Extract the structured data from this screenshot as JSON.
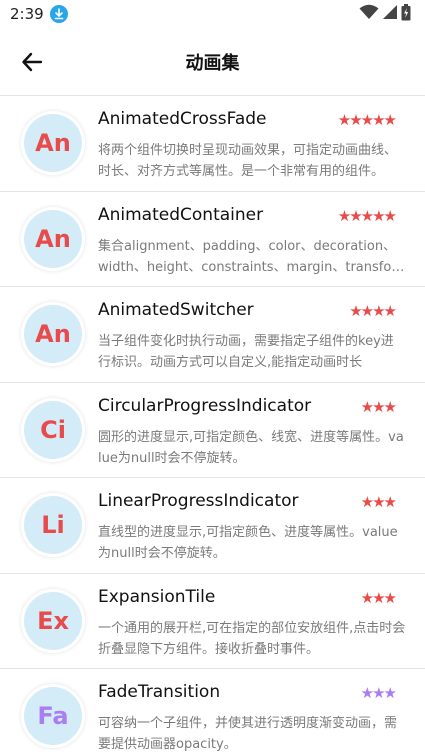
{
  "status": {
    "time": "2:39",
    "download_icon": "download-icon",
    "wifi_icon": "wifi-icon",
    "signal_icon": "signal-icon",
    "battery_icon": "battery-icon"
  },
  "app_bar": {
    "title": "动画集",
    "back_icon": "arrow-back-icon"
  },
  "colors": {
    "avatar_bg": "#d4ecf8",
    "red": "#e84b4b",
    "purple": "#a97ef0"
  },
  "items": [
    {
      "abbr": "An",
      "title": "AnimatedCrossFade",
      "stars": "★★★★★",
      "color": "#e84b4b",
      "desc": "将两个组件切换时呈现动画效果，可指定动画曲线、时长、对齐方式等属性。是一个非常有用的组件。"
    },
    {
      "abbr": "An",
      "title": "AnimatedContainer",
      "stars": "★★★★★",
      "color": "#e84b4b",
      "desc": "集合alignment、padding、color、decoration、width、height、constraints、margin、transform等属性"
    },
    {
      "abbr": "An",
      "title": "AnimatedSwitcher",
      "stars": "★★★★",
      "color": "#e84b4b",
      "desc": "当子组件变化时执行动画，需要指定子组件的key进行标识。动画方式可以自定义,能指定动画时长"
    },
    {
      "abbr": "Ci",
      "title": "CircularProgressIndicator",
      "stars": "★★★",
      "color": "#e84b4b",
      "desc": "圆形的进度显示,可指定颜色、线宽、进度等属性。value为null时会不停旋转。"
    },
    {
      "abbr": "Li",
      "title": "LinearProgressIndicator",
      "stars": "★★★",
      "color": "#e84b4b",
      "desc": "直线型的进度显示,可指定颜色、进度等属性。value为null时会不停旋转。"
    },
    {
      "abbr": "Ex",
      "title": "ExpansionTile",
      "stars": "★★★",
      "color": "#e84b4b",
      "desc": "一个通用的展开栏,可在指定的部位安放组件,点击时会折叠显隐下方组件。接收折叠时事件。"
    },
    {
      "abbr": "Fa",
      "title": "FadeTransition",
      "stars": "★★★",
      "color": "#a97ef0",
      "desc": "可容纳一个子组件，并使其进行透明度渐变动画，需要提供动画器opacity。"
    }
  ]
}
